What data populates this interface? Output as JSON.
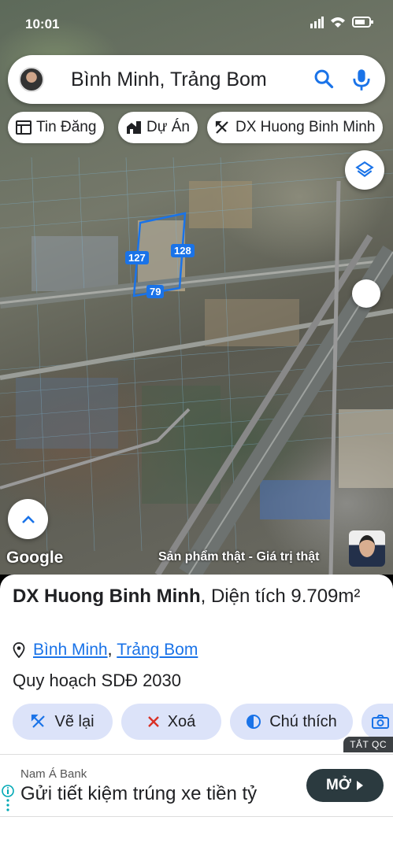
{
  "status_bar": {
    "time": "10:01"
  },
  "search": {
    "query": "Bình Minh, Trảng Bom"
  },
  "chips": [
    {
      "label": "Tin Đăng"
    },
    {
      "label": "Dự Án"
    },
    {
      "label": "DX Huong Binh Minh"
    }
  ],
  "map": {
    "parcel_labels": [
      "127",
      "128",
      "79"
    ],
    "watermark": "Google",
    "tagline": "Sản phẩm thật - Giá trị thật",
    "accent_color": "#1a73e8"
  },
  "detail": {
    "title_bold": "DX Huong Binh Minh",
    "title_rest": ", Diện tích 9.709m²",
    "location_ward": "Bình Minh",
    "location_sep": ", ",
    "location_district": "Trảng Bom",
    "plan_label": "Quy hoạch SDĐ 2030",
    "actions": [
      {
        "label": "Vẽ lại",
        "icon": "draw-icon"
      },
      {
        "label": "Xoá",
        "icon": "close-icon"
      },
      {
        "label": "Chú thích",
        "icon": "legend-icon"
      },
      {
        "label": "",
        "icon": "camera-icon"
      }
    ]
  },
  "ad": {
    "close_label": "TẮT QC",
    "advertiser": "Nam Á Bank",
    "headline": "Gửi tiết kiệm trúng xe tiền tỷ",
    "cta": "MỞ"
  }
}
